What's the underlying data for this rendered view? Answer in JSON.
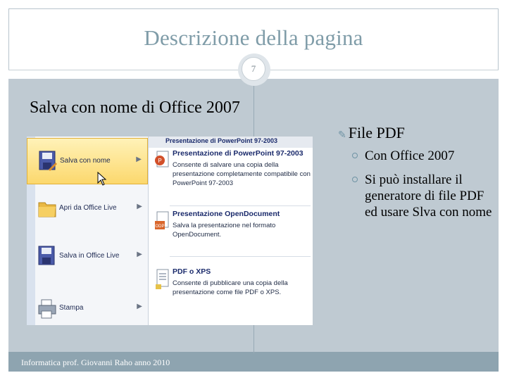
{
  "slide": {
    "title": "Descrizione della pagina",
    "page_number": "7",
    "heading": "Salva con nome di Office 2007",
    "footer": "Informatica prof. Giovanni Raho anno 2010"
  },
  "office_menu": {
    "top_cut_label": "Presentazione di PowerPoint 97-2003",
    "items": [
      {
        "label": "Salva con nome",
        "icon": "floppy-disk-icon",
        "active": true
      },
      {
        "label": "Apri da Office Live",
        "icon": "folder-icon",
        "active": false
      },
      {
        "label": "Salva in Office Live",
        "icon": "floppy-disk-icon",
        "active": false
      },
      {
        "label": "Stampa",
        "icon": "printer-icon",
        "active": false
      }
    ],
    "submenu": [
      {
        "title": "Presentazione di PowerPoint 97-2003",
        "desc": "Consente di salvare una copia della presentazione completamente compatibile con PowerPoint 97-2003",
        "icon": "powerpoint-file-icon"
      },
      {
        "title": "Presentazione OpenDocument",
        "desc": "Salva la presentazione nel formato OpenDocument.",
        "icon": "odp-file-icon"
      },
      {
        "title": "PDF o XPS",
        "desc": "Consente di pubblicare una copia della presentazione come file PDF o XPS.",
        "icon": "pdf-file-icon"
      }
    ]
  },
  "right_list": {
    "title": "File PDF",
    "items": [
      "Con Office 2007",
      "Si può installare il generatore di  file PDF ed usare Slva con nome"
    ]
  },
  "colors": {
    "title": "#7f9ca8",
    "panel": "#bfcad2",
    "footer_band": "#8ea4b0",
    "bullet_accent": "#6f93a4",
    "menu_highlight": "#fcd86d"
  }
}
